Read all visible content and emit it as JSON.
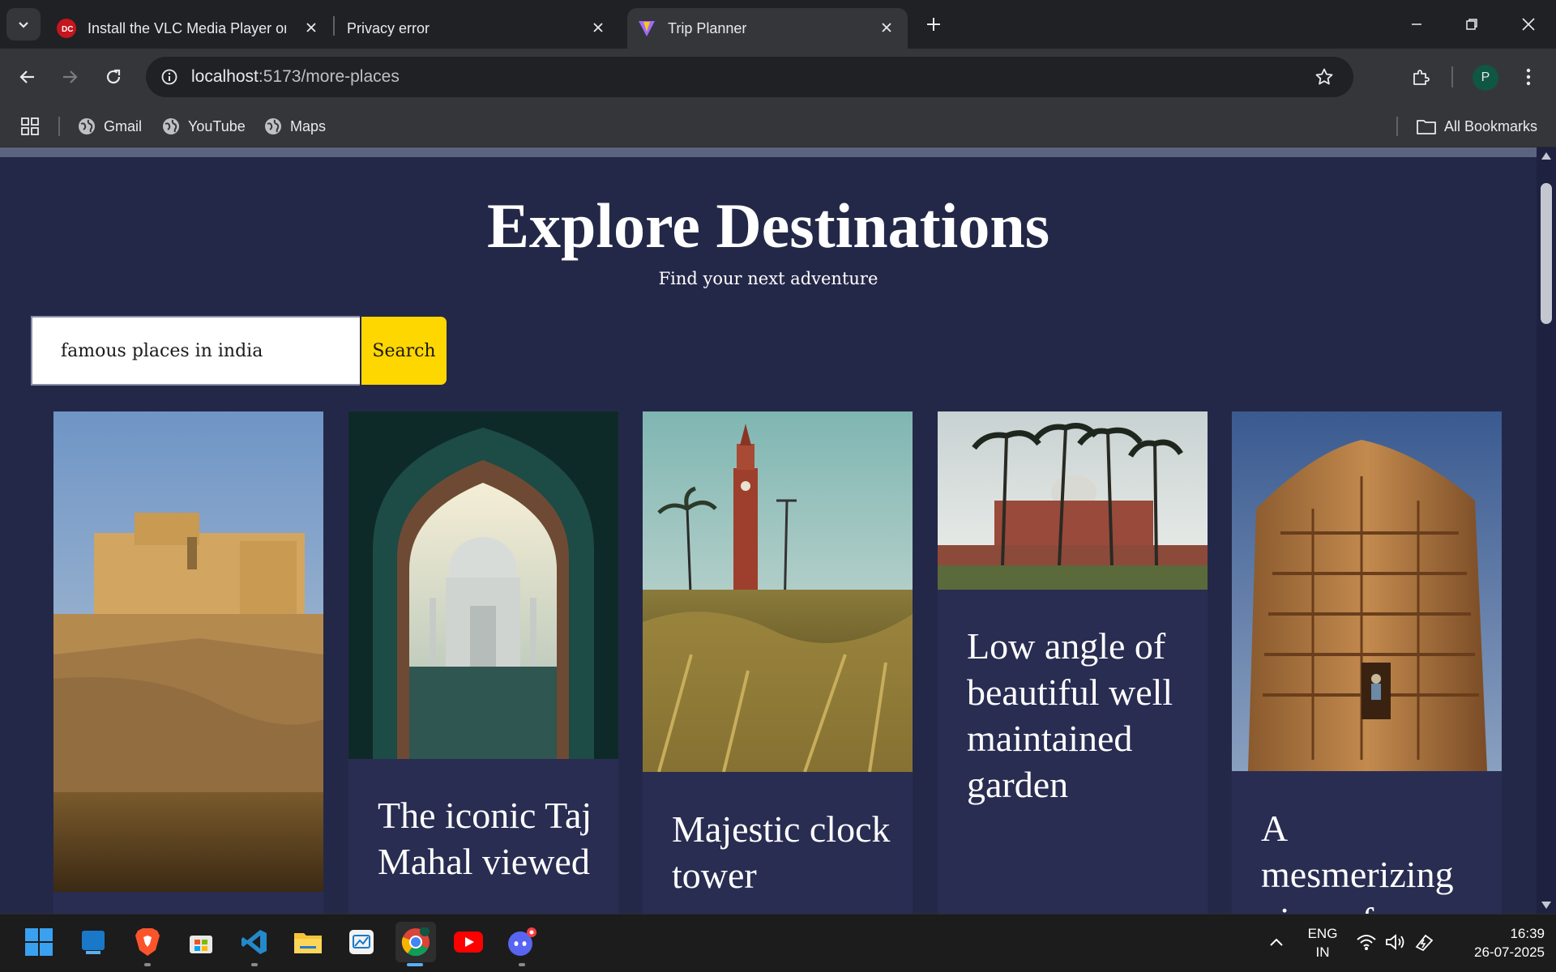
{
  "browser": {
    "tabs": [
      {
        "title": "Install the VLC Media Player on",
        "favicon": "vlc-install-site-icon",
        "active": false
      },
      {
        "title": "Privacy error",
        "favicon": "none",
        "active": false
      },
      {
        "title": "Trip Planner",
        "favicon": "vite-logo-icon",
        "active": true
      }
    ],
    "url_host": "localhost",
    "url_path": ":5173/more-places",
    "profile_initial": "P",
    "bookmarks": [
      {
        "label": "Gmail",
        "icon": "globe-icon"
      },
      {
        "label": "YouTube",
        "icon": "globe-icon"
      },
      {
        "label": "Maps",
        "icon": "globe-icon"
      }
    ],
    "all_bookmarks_label": "All Bookmarks"
  },
  "page": {
    "title": "Explore Destinations",
    "subtitle": "Find your next adventure",
    "search": {
      "value": "famous places in india",
      "button_label": "Search"
    },
    "cards": [
      {
        "caption": "",
        "image": "amber-fort-photo"
      },
      {
        "caption": "The iconic Taj Mahal viewed",
        "image": "taj-mahal-arch-photo"
      },
      {
        "caption": "Majestic clock tower",
        "image": "clock-tower-photo"
      },
      {
        "caption": "Low angle of beautiful well maintained garden",
        "image": "humayun-tomb-photo"
      },
      {
        "caption": "A mesmerizing view of a",
        "image": "stone-temple-photo"
      }
    ]
  },
  "taskbar": {
    "apps": [
      "windows-start-icon",
      "widgets-icon",
      "brave-icon",
      "store-icon",
      "vscode-icon",
      "file-explorer-icon",
      "app-icon",
      "chrome-icon",
      "youtube-icon",
      "discord-icon"
    ],
    "language": "ENG",
    "region": "IN",
    "time": "16:39",
    "date": "26-07-2025"
  },
  "colors": {
    "page_bg": "#242848",
    "card_bg": "#292d52",
    "search_button": "#ffd700"
  }
}
